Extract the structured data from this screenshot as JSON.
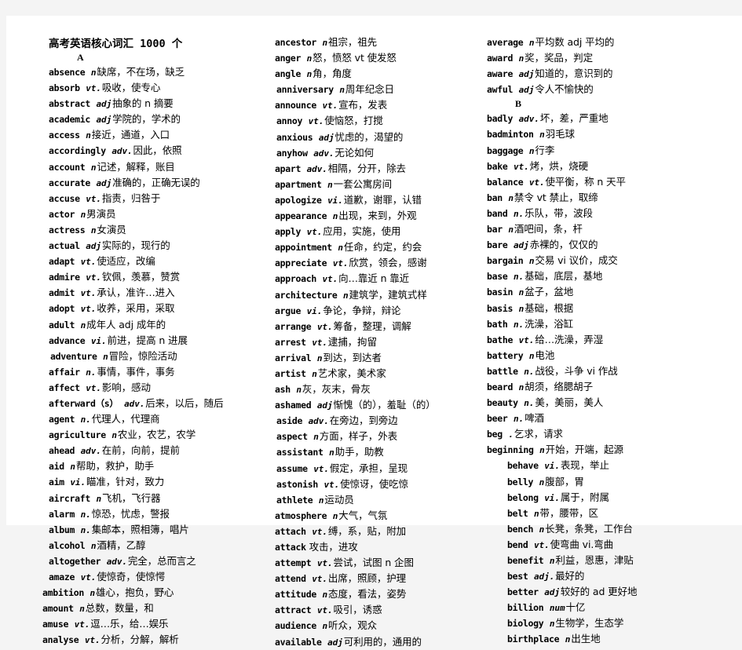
{
  "document": {
    "title": "高考英语核心词汇 1000 个",
    "page_background": "#f4f4f4",
    "paper_background": "#ffffff"
  },
  "columns": [
    {
      "id": "column-1",
      "letter_heading": "A",
      "entries": [
        {
          "word": "absence",
          "pos": "n",
          "def": "缺席，不在场，缺乏",
          "indent": "ind-0"
        },
        {
          "word": "absorb",
          "pos": "vt.",
          "def": "吸收，使专心",
          "indent": "ind-0"
        },
        {
          "word": "abstract",
          "pos": "adj",
          "def": "抽象的 n 摘要",
          "indent": "ind-0"
        },
        {
          "word": "academic",
          "pos": "adj",
          "def": "学院的，学术的",
          "indent": "ind-0"
        },
        {
          "word": "access",
          "pos": "n",
          "def": "接近，通道，入口",
          "indent": "ind-0"
        },
        {
          "word": "accordingly",
          "pos": "adv.",
          "def": "因此，依照",
          "indent": "ind-0"
        },
        {
          "word": "account",
          "pos": "n",
          "def": "记述，解释，账目",
          "indent": "ind-0"
        },
        {
          "word": "accurate",
          "pos": "adj",
          "def": "准确的，正确无误的",
          "indent": "ind-0"
        },
        {
          "word": "accuse",
          "pos": "vt.",
          "def": "指责，归咎于",
          "indent": "ind-0"
        },
        {
          "word": "actor",
          "pos": "n",
          "def": "男演员",
          "indent": "ind-0"
        },
        {
          "word": "actress",
          "pos": "n",
          "def": "女演员",
          "indent": "ind-0"
        },
        {
          "word": "actual",
          "pos": "adj",
          "def": "实际的，现行的",
          "indent": "ind-0"
        },
        {
          "word": "adapt",
          "pos": "vt.",
          "def": "使适应，改编",
          "indent": "ind-0"
        },
        {
          "word": "admire",
          "pos": "vt.",
          "def": "钦佩，羡慕，赞赏",
          "indent": "ind-0"
        },
        {
          "word": "admit",
          "pos": "vt.",
          "def": "承认，准许…进入",
          "indent": "ind-0"
        },
        {
          "word": "adopt",
          "pos": "vt.",
          "def": "收养，采用，采取",
          "indent": "ind-0"
        },
        {
          "word": "adult",
          "pos": "n",
          "def": "成年人 adj 成年的",
          "indent": "ind-0"
        },
        {
          "word": "advance",
          "pos": "vi.",
          "def": "前进，提高 n 进展",
          "indent": "ind-0"
        },
        {
          "word": "adventure",
          "pos": "n",
          "def": "冒险，惊险活动",
          "indent": "ind-1"
        },
        {
          "word": "affair",
          "pos": "n.",
          "def": "事情，事件，事务",
          "indent": "ind-0"
        },
        {
          "word": "affect",
          "pos": "vt.",
          "def": "影响，感动",
          "indent": "ind-0"
        },
        {
          "word": "afterward（s）",
          "pos": "adv.",
          "def": "后来，以后，随后",
          "indent": "ind-0"
        },
        {
          "word": "agent",
          "pos": "n.",
          "def": "代理人，代理商",
          "indent": "ind-0"
        },
        {
          "word": "agriculture",
          "pos": "n",
          "def": "农业，农艺，农学",
          "indent": "ind-0"
        },
        {
          "word": "ahead",
          "pos": "adv.",
          "def": "在前，向前，提前",
          "indent": "ind-0"
        },
        {
          "word": "aid",
          "pos": "n",
          "def": "帮助，救护，助手",
          "indent": "ind-0"
        },
        {
          "word": "aim",
          "pos": "vi.",
          "def": "瞄准，针对，致力",
          "indent": "ind-0"
        },
        {
          "word": "aircraft",
          "pos": "n",
          "def": "飞机，飞行器",
          "indent": "ind-0"
        },
        {
          "word": "alarm",
          "pos": "n.",
          "def": "惊恐，忧虑，警报",
          "indent": "ind-0"
        },
        {
          "word": "album",
          "pos": "n.",
          "def": "集邮本，照相簿，唱片",
          "indent": "ind-0"
        },
        {
          "word": "alcohol",
          "pos": "n",
          "def": "酒精，乙醇",
          "indent": "ind-0"
        },
        {
          "word": "altogether",
          "pos": "adv.",
          "def": "完全，总而言之",
          "indent": "ind-0"
        },
        {
          "word": "amaze",
          "pos": "vt.",
          "def": "使惊奇，使惊愕",
          "indent": "ind-0"
        },
        {
          "word": "ambition",
          "pos": "n",
          "def": "雄心，抱负，野心",
          "indent": "ind-n2"
        },
        {
          "word": "amount",
          "pos": "n",
          "def": "总数，数量，和",
          "indent": "ind-n2"
        },
        {
          "word": "amuse",
          "pos": "vt.",
          "def": "逗…乐，给…娱乐",
          "indent": "ind-n2"
        },
        {
          "word": "analyse",
          "pos": "vt.",
          "def": "分析，分解，解析",
          "indent": "ind-n2"
        }
      ]
    },
    {
      "id": "column-2",
      "letter_heading": "",
      "entries": [
        {
          "word": "ancestor",
          "pos": "n",
          "def": "祖宗，祖先",
          "indent": "ind-0"
        },
        {
          "word": "anger",
          "pos": "n",
          "def": "怒，愤怒 vt 使发怒",
          "indent": "ind-0"
        },
        {
          "word": "angle",
          "pos": "n",
          "def": "角，角度",
          "indent": "ind-0"
        },
        {
          "word": "anniversary",
          "pos": "n",
          "def": "周年纪念日",
          "indent": "ind-1"
        },
        {
          "word": "announce",
          "pos": "vt.",
          "def": "宣布，发表",
          "indent": "ind-0"
        },
        {
          "word": "annoy",
          "pos": "vt.",
          "def": "使恼怒，打搅",
          "indent": "ind-1"
        },
        {
          "word": "anxious",
          "pos": "adj",
          "def": "忧虑的，渴望的",
          "indent": "ind-1"
        },
        {
          "word": "anyhow",
          "pos": "adv.",
          "def": "无论如何",
          "indent": "ind-1"
        },
        {
          "word": "apart",
          "pos": "adv.",
          "def": "相隔，分开，除去",
          "indent": "ind-0"
        },
        {
          "word": "apartment",
          "pos": "n",
          "def": "一套公寓房间",
          "indent": "ind-0"
        },
        {
          "word": "apologize",
          "pos": "vi.",
          "def": "道歉，谢罪，认错",
          "indent": "ind-0"
        },
        {
          "word": "appearance",
          "pos": "n",
          "def": "出现，来到，外观",
          "indent": "ind-0"
        },
        {
          "word": "apply",
          "pos": "vt.",
          "def": "应用，实施，使用",
          "indent": "ind-0"
        },
        {
          "word": "appointment",
          "pos": "n",
          "def": "任命，约定，约会",
          "indent": "ind-0"
        },
        {
          "word": "appreciate",
          "pos": "vt.",
          "def": "欣赏，领会，感谢",
          "indent": "ind-0"
        },
        {
          "word": "approach",
          "pos": "vt.",
          "def": "向…靠近 n 靠近",
          "indent": "ind-0"
        },
        {
          "word": "architecture",
          "pos": "n",
          "def": "建筑学，建筑式样",
          "indent": "ind-0"
        },
        {
          "word": "argue",
          "pos": "vi.",
          "def": "争论，争辩，辩论",
          "indent": "ind-0"
        },
        {
          "word": "arrange",
          "pos": "vt.",
          "def": "筹备，整理，调解",
          "indent": "ind-0"
        },
        {
          "word": "arrest",
          "pos": "vt.",
          "def": "逮捕，拘留",
          "indent": "ind-0"
        },
        {
          "word": "arrival",
          "pos": "n",
          "def": "到达，到达者",
          "indent": "ind-0"
        },
        {
          "word": "artist",
          "pos": "n",
          "def": "艺术家，美术家",
          "indent": "ind-0"
        },
        {
          "word": "ash",
          "pos": "n",
          "def": "灰，灰末，骨灰",
          "indent": "ind-0"
        },
        {
          "word": "ashamed",
          "pos": "adj",
          "def": "惭愧（的），羞耻（的）",
          "indent": "ind-0"
        },
        {
          "word": "aside",
          "pos": "adv.",
          "def": "在旁边，到旁边",
          "indent": "ind-1"
        },
        {
          "word": "aspect",
          "pos": "n",
          "def": "方面，样子，外表",
          "indent": "ind-1"
        },
        {
          "word": "assistant",
          "pos": "n",
          "def": "助手，助教",
          "indent": "ind-1"
        },
        {
          "word": "assume",
          "pos": "vt.",
          "def": "假定，承担，呈现",
          "indent": "ind-1"
        },
        {
          "word": "astonish",
          "pos": "vt.",
          "def": "使惊讶，使吃惊",
          "indent": "ind-1"
        },
        {
          "word": "athlete",
          "pos": "n",
          "def": "运动员",
          "indent": "ind-1"
        },
        {
          "word": "atmosphere",
          "pos": "n",
          "def": "大气，气氛",
          "indent": "ind-0"
        },
        {
          "word": "attach",
          "pos": "vt.",
          "def": "缚，系，贴，附加",
          "indent": "ind-0"
        },
        {
          "word": "attack",
          "pos": "",
          "def": "攻击，进攻",
          "indent": "ind-0"
        },
        {
          "word": "attempt",
          "pos": "vt.",
          "def": "尝试，试图 n 企图",
          "indent": "ind-0"
        },
        {
          "word": "attend",
          "pos": "vt.",
          "def": "出席，照顾，护理",
          "indent": "ind-0"
        },
        {
          "word": "attitude",
          "pos": "n",
          "def": "态度，看法，姿势",
          "indent": "ind-0"
        },
        {
          "word": "attract",
          "pos": "vt.",
          "def": "吸引，诱惑",
          "indent": "ind-0"
        },
        {
          "word": "audience",
          "pos": "n",
          "def": "听众，观众",
          "indent": "ind-0"
        },
        {
          "word": "available",
          "pos": "adj",
          "def": "可利用的，通用的",
          "indent": "ind-0"
        }
      ]
    },
    {
      "id": "column-3",
      "letter_heading": "B",
      "entries": [
        {
          "word": "average",
          "pos": "n",
          "def": "平均数 adj 平均的",
          "indent": "ind-0"
        },
        {
          "word": "award",
          "pos": "n",
          "def": "奖，奖品，判定",
          "indent": "ind-0"
        },
        {
          "word": "aware",
          "pos": "adj",
          "def": "知道的，意识到的",
          "indent": "ind-0"
        },
        {
          "word": "awful",
          "pos": "adj",
          "def": "令人不愉快的",
          "indent": "ind-0"
        },
        {
          "word": "__LETTER_B__",
          "pos": "",
          "def": "",
          "indent": "ind-0"
        },
        {
          "word": "badly",
          "pos": "adv.",
          "def": "坏，差，严重地",
          "indent": "ind-0"
        },
        {
          "word": "badminton",
          "pos": "n",
          "def": "羽毛球",
          "indent": "ind-0"
        },
        {
          "word": "baggage",
          "pos": "n",
          "def": "行李",
          "indent": "ind-0"
        },
        {
          "word": "bake",
          "pos": "vt.",
          "def": "烤，烘，烧硬",
          "indent": "ind-0"
        },
        {
          "word": "balance",
          "pos": "vt.",
          "def": "使平衡，称 n 天平",
          "indent": "ind-0"
        },
        {
          "word": "ban",
          "pos": "n",
          "def": "禁令 vt 禁止，取缔",
          "indent": "ind-0"
        },
        {
          "word": "band",
          "pos": "n.",
          "def": "乐队，带，波段",
          "indent": "ind-0"
        },
        {
          "word": "bar",
          "pos": "n",
          "def": "酒吧间，条，杆",
          "indent": "ind-0"
        },
        {
          "word": "bare",
          "pos": "adj",
          "def": "赤裸的，仅仅的",
          "indent": "ind-0"
        },
        {
          "word": "bargain",
          "pos": "n",
          "def": "交易 vi 议价，成交",
          "indent": "ind-0"
        },
        {
          "word": "base",
          "pos": "n.",
          "def": "基础，底层，基地",
          "indent": "ind-0"
        },
        {
          "word": "basin",
          "pos": "n",
          "def": "盆子，盆地",
          "indent": "ind-0"
        },
        {
          "word": "basis",
          "pos": "n",
          "def": "基础，根据",
          "indent": "ind-0"
        },
        {
          "word": "bath",
          "pos": "n.",
          "def": "洗澡，浴缸",
          "indent": "ind-0"
        },
        {
          "word": "bathe",
          "pos": "vt.",
          "def": "给…洗澡，弄湿",
          "indent": "ind-0"
        },
        {
          "word": "battery",
          "pos": "n",
          "def": "电池",
          "indent": "ind-0"
        },
        {
          "word": "battle",
          "pos": "n.",
          "def": "战役，斗争 vi 作战",
          "indent": "ind-0"
        },
        {
          "word": "beard",
          "pos": "n",
          "def": "胡须，络腮胡子",
          "indent": "ind-0"
        },
        {
          "word": "beauty",
          "pos": "n.",
          "def": "美，美丽，美人",
          "indent": "ind-0"
        },
        {
          "word": "beer",
          "pos": "n.",
          "def": "啤酒",
          "indent": "ind-0"
        },
        {
          "word": "beg",
          "pos": ".",
          "def": "乞求，请求",
          "indent": "ind-0"
        },
        {
          "word": "beginning",
          "pos": "n",
          "def": "开始，开端，起源",
          "indent": "ind-0"
        },
        {
          "word": "behave",
          "pos": "vi.",
          "def": "表现，举止",
          "indent": "ind-big"
        },
        {
          "word": "belly",
          "pos": "n",
          "def": "腹部，胃",
          "indent": "ind-big"
        },
        {
          "word": "belong",
          "pos": "vi.",
          "def": "属于，附属",
          "indent": "ind-big"
        },
        {
          "word": "belt",
          "pos": "n",
          "def": "带，腰带，区",
          "indent": "ind-big"
        },
        {
          "word": "bench",
          "pos": "n",
          "def": "长凳，条凳，工作台",
          "indent": "ind-big"
        },
        {
          "word": "bend",
          "pos": "vt.",
          "def": "使弯曲 vi.弯曲",
          "indent": "ind-big"
        },
        {
          "word": "benefit",
          "pos": "n",
          "def": "利益，恩惠，津贴",
          "indent": "ind-big"
        },
        {
          "word": "best",
          "pos": "adj.",
          "def": "最好的",
          "indent": "ind-big"
        },
        {
          "word": "better",
          "pos": "adj",
          "def": "较好的 ad 更好地",
          "indent": "ind-big"
        },
        {
          "word": "billion",
          "pos": "num",
          "def": "十亿",
          "indent": "ind-big"
        },
        {
          "word": "biology",
          "pos": "n",
          "def": "生物学，生态学",
          "indent": "ind-big"
        },
        {
          "word": "birthplace",
          "pos": "n",
          "def": "出生地",
          "indent": "ind-big"
        }
      ]
    }
  ]
}
